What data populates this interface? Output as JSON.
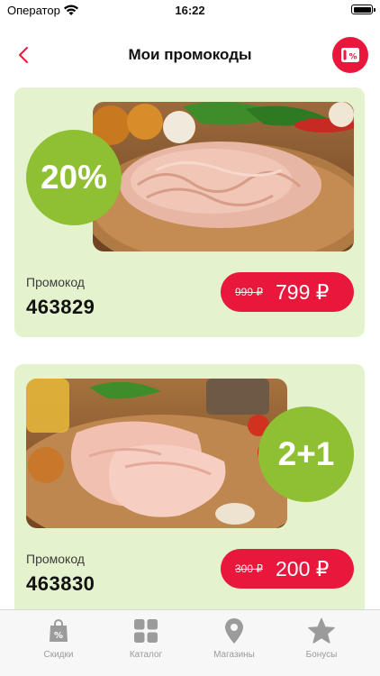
{
  "status_bar": {
    "carrier": "Оператор",
    "time": "16:22",
    "battery_level": 1.0
  },
  "nav": {
    "title": "Мои промокоды",
    "back_icon": "chevron-left-icon",
    "action_icon": "promo-ticket-icon"
  },
  "colors": {
    "accent": "#e8173b",
    "card_bg": "#e4f3cd",
    "badge_green": "#8fbf32",
    "tab_inactive": "#9b9b9b"
  },
  "promos": [
    {
      "discount": "20%",
      "label": "Промокод",
      "code": "463829",
      "old_price": "999 ₽",
      "new_price": "799 ₽",
      "image": "minced-meat-photo"
    },
    {
      "discount": "2+1",
      "label": "Промокод",
      "code": "463830",
      "old_price": "300 ₽",
      "new_price": "200 ₽",
      "image": "chicken-fillet-photo"
    }
  ],
  "tabs": [
    {
      "label": "Скидки",
      "icon": "shopping-bag-percent-icon"
    },
    {
      "label": "Каталог",
      "icon": "grid-icon"
    },
    {
      "label": "Магазины",
      "icon": "location-pin-icon"
    },
    {
      "label": "Бонусы",
      "icon": "star-icon"
    }
  ]
}
